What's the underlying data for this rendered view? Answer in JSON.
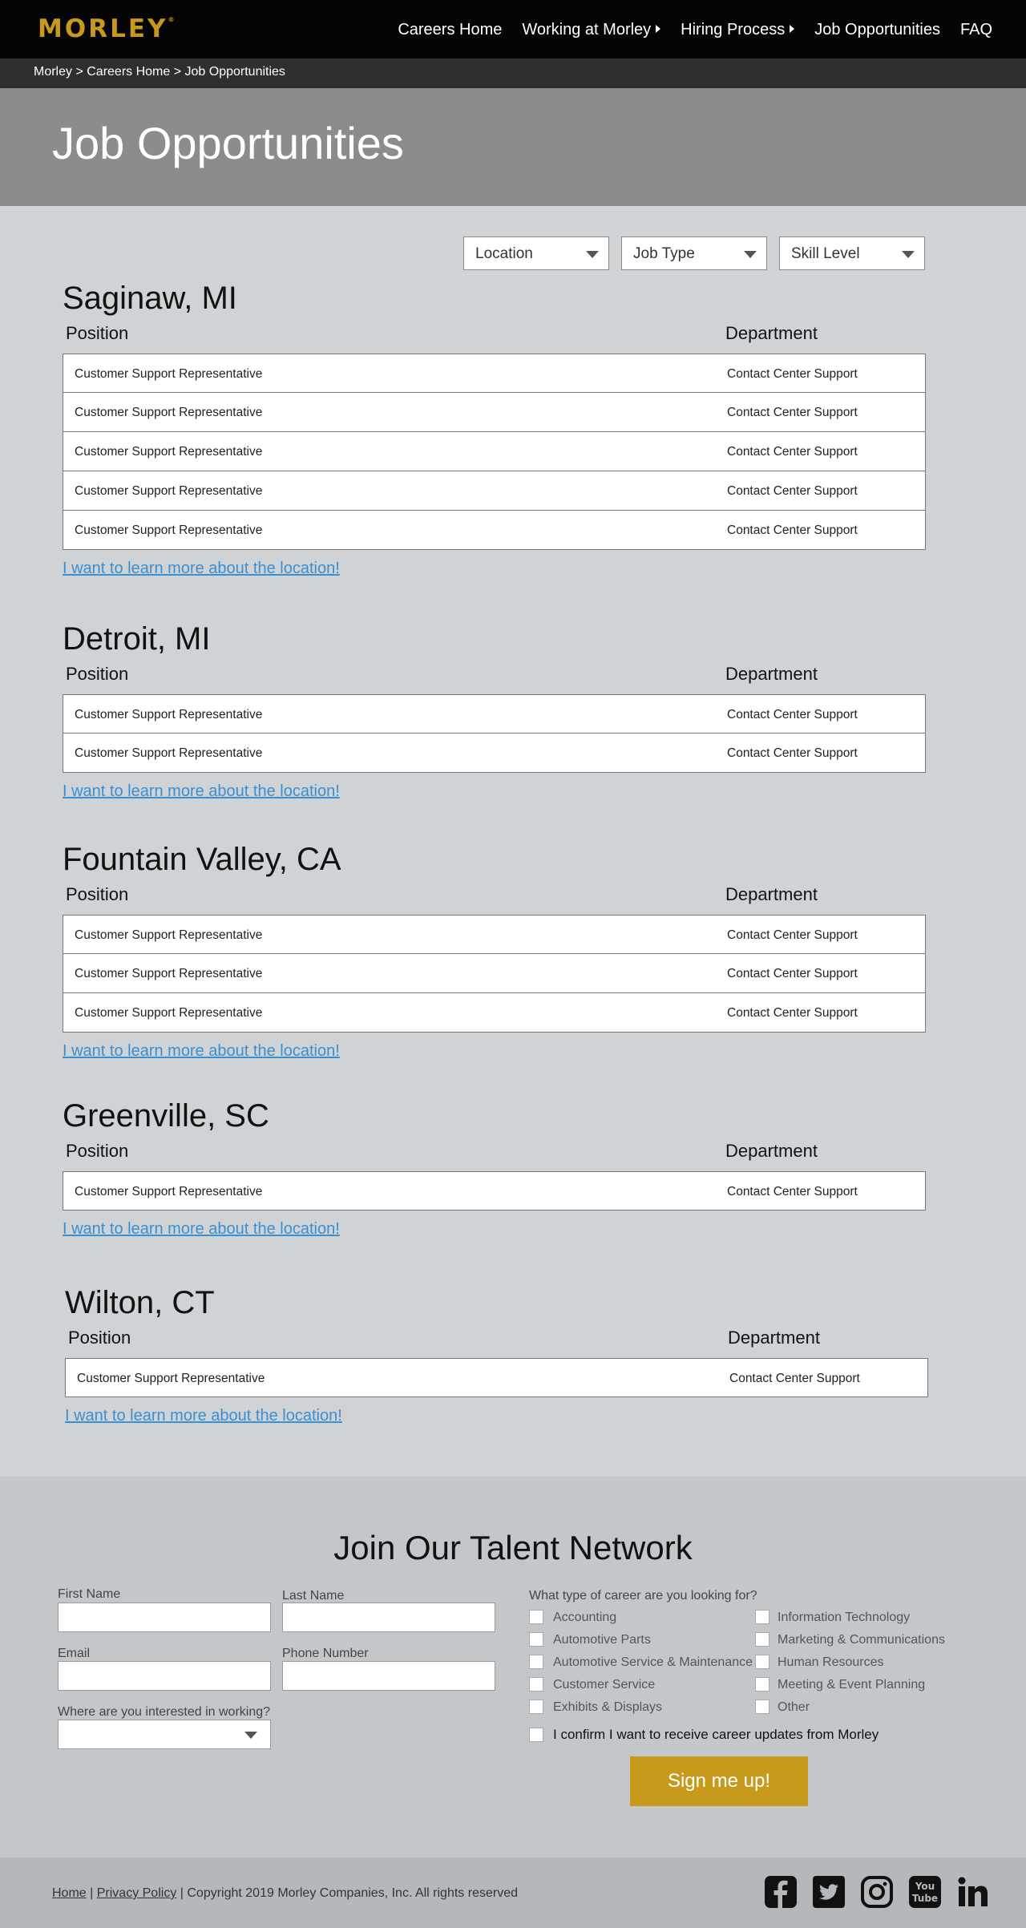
{
  "header": {
    "logo": "MORLEY",
    "logo_mark": "®",
    "nav": [
      {
        "label": "Careers Home"
      },
      {
        "label": "Working at Morley"
      },
      {
        "label": "Hiring Process"
      },
      {
        "label": "Job Opportunities"
      },
      {
        "label": "FAQ"
      }
    ]
  },
  "breadcrumb": {
    "items": [
      "Morley",
      "Careers Home",
      "Job Opportunities"
    ],
    "separator": " > "
  },
  "hero": {
    "title": "Job Opportunities"
  },
  "filters": {
    "location": "Location",
    "job_type": "Job Type",
    "skill_level": "Skill Level"
  },
  "locations": [
    {
      "name": "Saginaw, MI",
      "position_header": "Position",
      "department_header": "Department",
      "jobs": [
        {
          "position": "Customer Support Representative",
          "department": "Contact Center Support"
        },
        {
          "position": "Customer Support Representative",
          "department": "Contact Center Support"
        },
        {
          "position": "Customer Support Representative",
          "department": "Contact Center Support"
        },
        {
          "position": "Customer Support Representative",
          "department": "Contact Center Support"
        },
        {
          "position": "Customer Support Representative",
          "department": "Contact Center Support"
        }
      ],
      "learn_more": "I want to learn more about the location!"
    },
    {
      "name": "Detroit, MI",
      "position_header": "Position",
      "department_header": "Department",
      "jobs": [
        {
          "position": "Customer Support Representative",
          "department": "Contact Center Support"
        },
        {
          "position": "Customer Support Representative",
          "department": "Contact Center Support"
        }
      ],
      "learn_more": "I want to learn more about the location!"
    },
    {
      "name": "Fountain Valley, CA",
      "position_header": "Position",
      "department_header": "Department",
      "jobs": [
        {
          "position": "Customer Support Representative",
          "department": "Contact Center Support"
        },
        {
          "position": "Customer Support Representative",
          "department": "Contact Center Support"
        },
        {
          "position": "Customer Support Representative",
          "department": "Contact Center Support"
        }
      ],
      "learn_more": "I want to learn more about the location!"
    },
    {
      "name": "Greenville, SC",
      "position_header": "Position",
      "department_header": "Department",
      "jobs": [
        {
          "position": "Customer Support Representative",
          "department": "Contact Center Support"
        }
      ],
      "learn_more": "I want to learn more about the location!"
    },
    {
      "name": "Wilton, CT",
      "position_header": "Position",
      "department_header": "Department",
      "jobs": [
        {
          "position": "Customer Support Representative",
          "department": "Contact Center Support"
        }
      ],
      "learn_more": "I want to learn more about the location!"
    }
  ],
  "talent": {
    "title": "Join Our Talent Network",
    "first_name": "First Name",
    "last_name": "Last Name",
    "email": "Email",
    "phone": "Phone Number",
    "where": "Where are you interested in working?",
    "career_question": "What type of career are you looking for?",
    "careers_left": [
      "Accounting",
      "Automotive Parts",
      "Automotive Service & Maintenance",
      "Customer Service",
      "Exhibits & Displays"
    ],
    "careers_right": [
      "Information Technology",
      "Marketing & Communications",
      "Human Resources",
      "Meeting & Event Planning",
      "Other"
    ],
    "confirm": "I confirm I want to receive career updates from Morley",
    "submit": "Sign me up!"
  },
  "footer": {
    "home": "Home",
    "privacy": "Privacy Policy",
    "copyright": "Copyright 2019 Morley Companies, Inc. All rights reserved",
    "sep": " | ",
    "social": [
      "facebook-icon",
      "twitter-icon",
      "instagram-icon",
      "youtube-icon",
      "linkedin-icon"
    ]
  },
  "colors": {
    "brand_gold": "#c89a1c",
    "link_blue": "#3b8fd0",
    "nav_black": "#050505",
    "hero_gray": "#8c8c8c"
  }
}
